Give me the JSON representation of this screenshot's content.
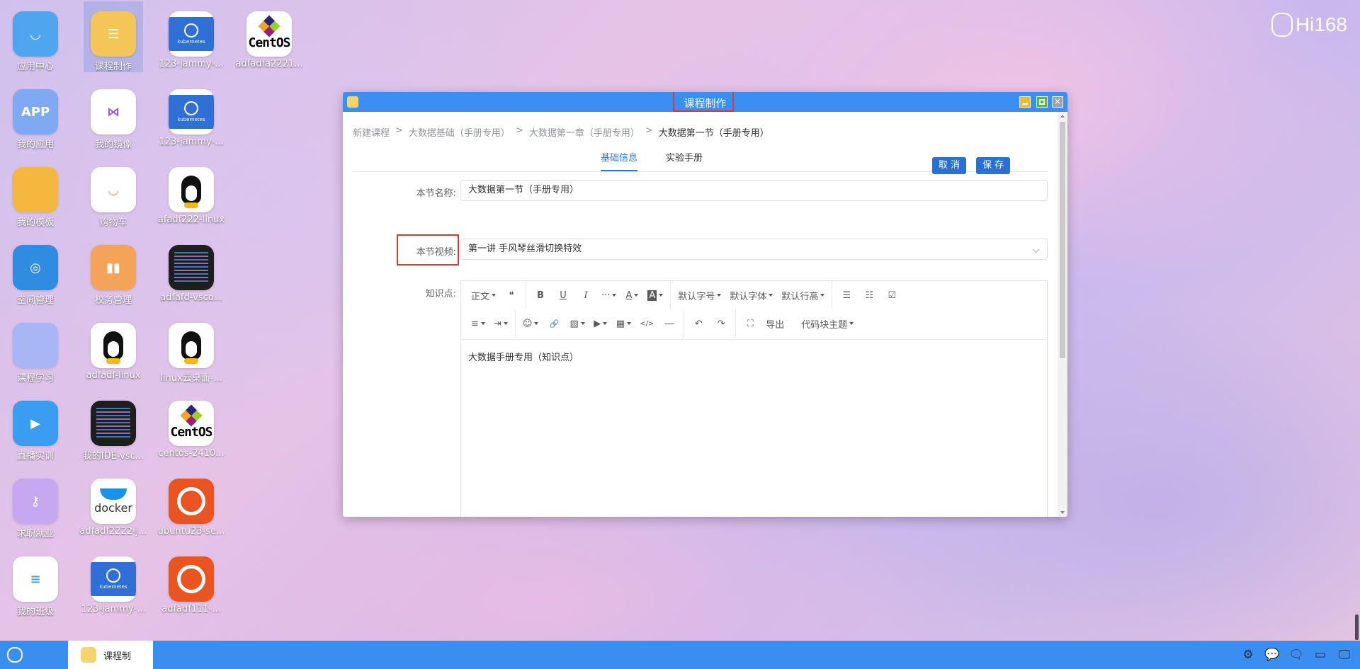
{
  "desktop": {
    "icons": [
      {
        "label": "应用中心",
        "glyph": "◡"
      },
      {
        "label": "课程制作",
        "glyph": "☰"
      },
      {
        "label": "123-jammy-...",
        "glyph": ""
      },
      {
        "label": "adfadfa2221...",
        "glyph": ""
      },
      {
        "label": "我的应用",
        "glyph": "APP"
      },
      {
        "label": "我的镜像",
        "glyph": "⋈"
      },
      {
        "label": "123-jammy-...",
        "glyph": ""
      },
      {
        "label": "我的模板",
        "glyph": ""
      },
      {
        "label": "购物车",
        "glyph": "◡"
      },
      {
        "label": "afadf222-linux",
        "glyph": ""
      },
      {
        "label": "空间管理",
        "glyph": "◎"
      },
      {
        "label": "校务管理",
        "glyph": "▮▮"
      },
      {
        "label": "adfafd-vsco...",
        "glyph": ""
      },
      {
        "label": "课程学习",
        "glyph": ""
      },
      {
        "label": "adfadf-linux",
        "glyph": ""
      },
      {
        "label": "linux云桌面-...",
        "glyph": ""
      },
      {
        "label": "直播实训",
        "glyph": "▶"
      },
      {
        "label": "我的IDE-vsc...",
        "glyph": ""
      },
      {
        "label": "centos-2410...",
        "glyph": ""
      },
      {
        "label": "求职就业",
        "glyph": "⚷"
      },
      {
        "label": "adfadf2222-j...",
        "glyph": ""
      },
      {
        "label": "ubuntu23-se...",
        "glyph": ""
      },
      {
        "label": "我的班级",
        "glyph": "≡"
      },
      {
        "label": "123-jammy-...",
        "glyph": ""
      },
      {
        "label": "adfadf111-...",
        "glyph": ""
      }
    ],
    "k8s_text": "kubernetes",
    "centos_text": "CentOS",
    "docker_text": "docker",
    "brand": "Hi168"
  },
  "window": {
    "title": "课程制作",
    "close_glyph": "×",
    "breadcrumb": [
      "新建课程",
      "大数据基础（手册专用）",
      "大数据第一章（手册专用）",
      "大数据第一节（手册专用）"
    ],
    "breadcrumb_sep": ">",
    "tabs": [
      "基础信息",
      "实验手册"
    ],
    "cancel_label": "取 消",
    "save_label": "保 存",
    "form": {
      "name_label": "本节名称:",
      "name_value": "大数据第一节（手册专用）",
      "video_label": "本节视频:",
      "video_value": "第一讲 手风琴丝滑切换特效",
      "points_label": "知识点:"
    },
    "toolbar": {
      "heading": "正文",
      "quote": "❝",
      "bold": "B",
      "underline": "U",
      "italic": "I",
      "more": "···",
      "font_color": "A",
      "bg_color": "A",
      "font_size": "默认字号",
      "font_family": "默认字体",
      "line_height": "默认行高",
      "bullet_list": "☰",
      "numbered_list": "☷",
      "todo": "☑",
      "align": "≡",
      "indent": "⇥",
      "emoji": "☺",
      "link": "🔗",
      "image": "▨",
      "video": "▶",
      "table": "▦",
      "code": "</>",
      "divider": "―",
      "undo": "↶",
      "redo": "↷",
      "fullscreen": "⛶",
      "export": "导出",
      "code_theme": "代码块主题"
    },
    "editor_text": "大数据手册专用（知识点）"
  },
  "taskbar": {
    "item_label": "课程制",
    "tray": [
      "⚙",
      "💬",
      "🗨",
      "▭",
      "🖵"
    ]
  }
}
